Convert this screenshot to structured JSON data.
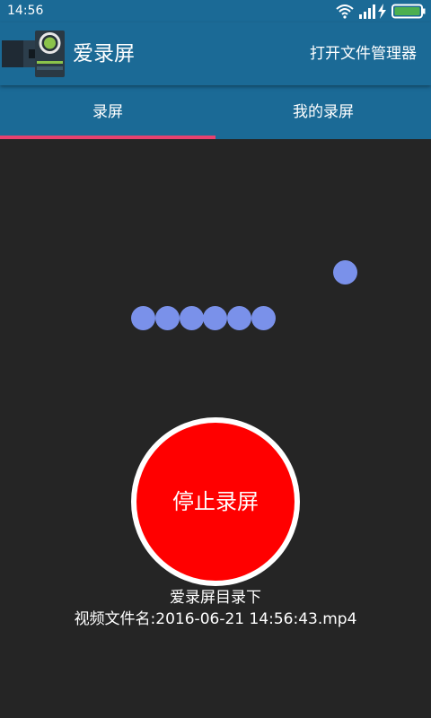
{
  "status_bar": {
    "time": "14:56",
    "icons": [
      "wifi-icon",
      "signal-icon",
      "charging-icon",
      "battery-icon"
    ],
    "battery_color": "#4caf50"
  },
  "action_bar": {
    "title": "爱录屏",
    "action_label": "打开文件管理器",
    "background_color": "#1b6a96"
  },
  "tabs": [
    {
      "label": "录屏",
      "selected": true
    },
    {
      "label": "我的录屏",
      "selected": false
    }
  ],
  "tab_indicator_color": "#e8416f",
  "loading_dots_color": "#7a91ea",
  "record_button": {
    "label": "停止录屏",
    "color": "#ff0000"
  },
  "save_info": {
    "line1": "爱录屏目录下",
    "line2": "视频文件名:2016-06-21 14:56:43.mp4"
  }
}
